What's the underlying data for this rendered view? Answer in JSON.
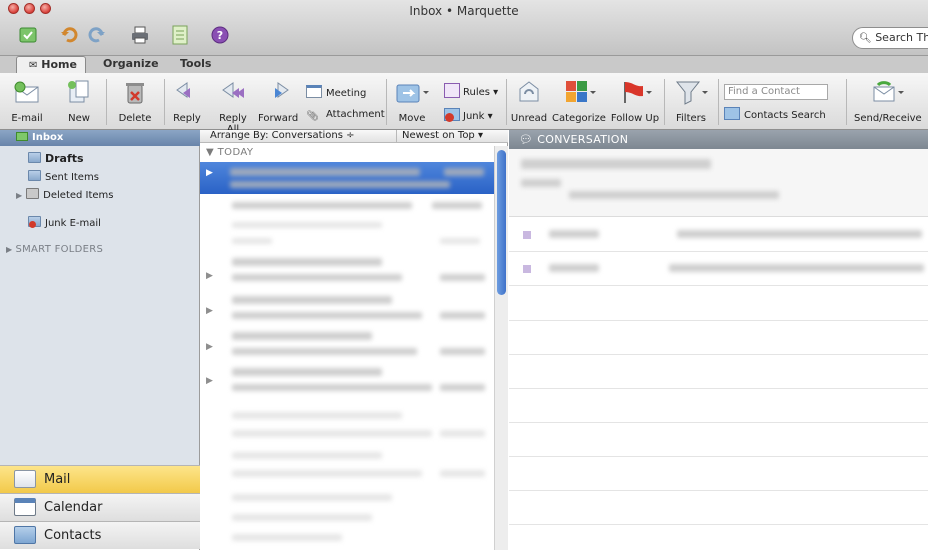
{
  "window": {
    "title": "Inbox • Marquette"
  },
  "search": {
    "placeholder": "Search Thi"
  },
  "tabs": [
    {
      "label": "Home"
    },
    {
      "label": "Organize"
    },
    {
      "label": "Tools"
    }
  ],
  "ribbon": {
    "email": "E-mail",
    "new": "New",
    "delete": "Delete",
    "reply": "Reply",
    "reply_all": "Reply All",
    "forward": "Forward",
    "meeting": "Meeting",
    "attachment": "Attachment",
    "move": "Move",
    "rules": "Rules",
    "junk": "Junk",
    "unread": "Unread",
    "categorize": "Categorize",
    "follow_up": "Follow Up",
    "filters": "Filters",
    "find_contact_placeholder": "Find a Contact",
    "contacts_search": "Contacts Search",
    "send_receive": "Send/Receive"
  },
  "sidebar": {
    "inbox": "Inbox",
    "drafts": "Drafts",
    "sent": "Sent Items",
    "deleted": "Deleted Items",
    "junk": "Junk E-mail",
    "smart_folders": "SMART FOLDERS"
  },
  "nav": {
    "mail": "Mail",
    "calendar": "Calendar",
    "contacts": "Contacts"
  },
  "list": {
    "arrange_by": "Arrange By: Conversations ÷",
    "sort_order": "Newest on Top ▾",
    "group_today": "▼ TODAY"
  },
  "reading": {
    "header": "CONVERSATION"
  },
  "colors": {
    "selection": "#2a62c6",
    "accent_yellow": "#f2c94a",
    "sidebar_bg": "#dde3ea"
  }
}
